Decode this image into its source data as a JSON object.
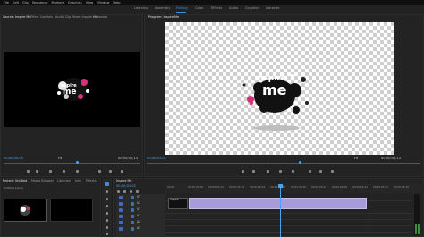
{
  "menu": [
    "File",
    "Edit",
    "Clip",
    "Sequence",
    "Markers",
    "Graphics",
    "View",
    "Window",
    "Help"
  ],
  "workspaces": [
    "Learning",
    "Assembly",
    "Editing",
    "Color",
    "Effects",
    "Audio",
    "Graphics",
    "Libraries"
  ],
  "active_workspace": "Editing",
  "source_panel": {
    "tabs": [
      "Source: Inspire Me",
      "Effect Controls",
      "Audio Clip Mixer: Inspire Me",
      "Metadata"
    ],
    "timecode_in": "00;00;00;00",
    "timecode_out": "00;00;05;13",
    "fit": "Fit"
  },
  "program_panel": {
    "tab": "Program: Inspire Me",
    "timecode": "00;00;01;02",
    "duration": "00;00;05;13",
    "fit": "Fit",
    "quality": "Full"
  },
  "logo": {
    "line1": "nspire",
    "line2": "me"
  },
  "project_panel": {
    "tabs": [
      "Project: Untitled",
      "Media Browser",
      "Libraries",
      "Info",
      "Effects"
    ],
    "path": "Untitled.prproj"
  },
  "timeline": {
    "tab": "Inspire Me",
    "timecode": "00;00;01;02",
    "ruler": [
      "00;00",
      "00;00;00;16",
      "00;00;01;02",
      "00;00;01;18",
      "00;00;02;04",
      "00;00;02;20",
      "00;00;03;06",
      "00;00;03;22",
      "00;00;04;08",
      "00;00;04;24",
      "00;00;05;10",
      "00;00;05;26"
    ],
    "tracks": [
      "V3",
      "V2",
      "V1",
      "A1",
      "A2",
      "A3"
    ],
    "clip_label": "Inspire"
  },
  "colors": {
    "accent": "#3a8ee6",
    "clip": "#a79bd9",
    "playhead": "#4aa3f0",
    "splash": "#d6307c"
  }
}
